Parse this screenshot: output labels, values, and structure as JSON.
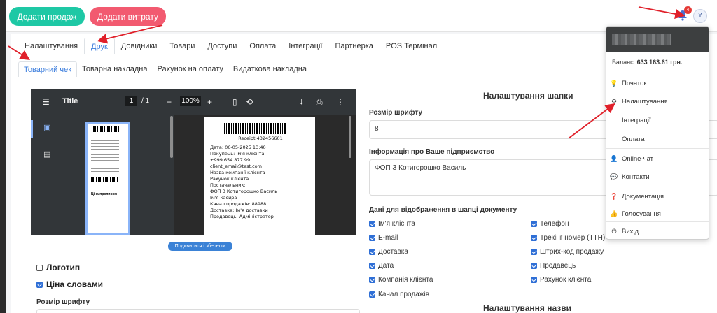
{
  "topbar": {
    "add_sale": "Додати продаж",
    "add_expense": "Додати витрату",
    "notification_count": "4",
    "avatar_letter": "Y"
  },
  "main_tabs": [
    {
      "label": "Налаштування"
    },
    {
      "label": "Друк"
    },
    {
      "label": "Довідники"
    },
    {
      "label": "Товари"
    },
    {
      "label": "Доступи"
    },
    {
      "label": "Оплата"
    },
    {
      "label": "Інтеграції"
    },
    {
      "label": "Партнерка"
    },
    {
      "label": "POS Термінал"
    }
  ],
  "sub_tabs": [
    {
      "label": "Товарний чек"
    },
    {
      "label": "Товарна накладна"
    },
    {
      "label": "Рахунок на оплату"
    },
    {
      "label": "Видаткова накладна"
    }
  ],
  "pdf": {
    "title": "Title",
    "page": "1",
    "total": "/ 1",
    "zoom": "100%",
    "receipt_number": "Receipt 432456601",
    "receipt_lines": [
      "Дата: 06-05-2025 13:40",
      "Покупець: Ім'я клієнта",
      "+999 654 877 99",
      "client_email@test.com",
      "Назва компанії клієнта",
      "Рахунок клієнта",
      "Постачальник:",
      "ФОП З Котигорошко Василь",
      "Ім'я касира",
      "Канал продажів: 88988",
      "Доставка: Ім'я доставки",
      "Продавець: Адміністратор"
    ],
    "thumb_text": "Ціна прописом"
  },
  "view_save": "Подивитися і зберегти",
  "left_checks": {
    "logo": "Логотип",
    "price_words": "Ціна словами"
  },
  "left_font_label": "Розмір шрифту",
  "header_settings": {
    "title": "Налаштування шапки",
    "font_label": "Розмір шрифту",
    "font_value": "8",
    "company_label": "Інформація про Ваше підприємство",
    "company_value": "ФОП З Котигорошко Василь",
    "doc_data_label": "Дані для відображення в шапці документу",
    "checks_left": [
      "Ім'я клієнта",
      "E-mail",
      "Доставка",
      "Дата",
      "Компанія клієнта",
      "Канал продажів"
    ],
    "checks_right": [
      "Телефон",
      "Трекінг номер (ТТН)",
      "Штрих-код продажу",
      "Продавець",
      "Рахунок клієнта"
    ]
  },
  "name_settings_title": "Налаштування назви",
  "dropdown": {
    "balance_label": "Баланс:",
    "balance_value": "633 163.61 грн.",
    "items": [
      {
        "label": "Початок",
        "icon": "lightbulb-icon"
      },
      {
        "label": "Налаштування",
        "icon": "gear-icon"
      },
      {
        "label": "Інтеграції",
        "icon": ""
      },
      {
        "label": "Оплата",
        "icon": ""
      },
      {
        "label": "Online-чат",
        "icon": "user-chat-icon"
      },
      {
        "label": "Контакти",
        "icon": "comments-icon"
      },
      {
        "label": "Документація",
        "icon": "question-circle-icon"
      },
      {
        "label": "Голосування",
        "icon": "thumbs-up-icon"
      },
      {
        "label": "Вихід",
        "icon": "power-icon"
      }
    ]
  },
  "colors": {
    "sale_button": "#1ec8a5",
    "expense_button": "#f25a70",
    "accent_blue": "#3b7ddd",
    "arrow_red": "#e0202a"
  }
}
